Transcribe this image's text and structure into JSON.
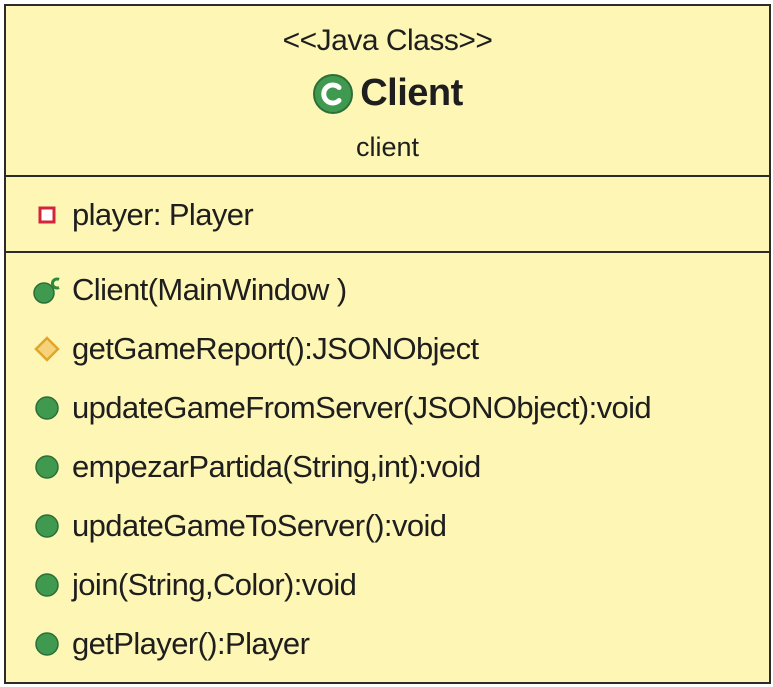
{
  "class_box": {
    "stereotype": "<<Java Class>>",
    "name": "Client",
    "package": "client"
  },
  "attributes": [
    {
      "text": "player: Player",
      "visibility": "private",
      "icon": "private-field-icon"
    }
  ],
  "operations": [
    {
      "text": "Client(MainWindow )",
      "visibility": "public",
      "icon": "constructor-icon"
    },
    {
      "text": "getGameReport():JSONObject",
      "visibility": "protected",
      "icon": "protected-method-icon"
    },
    {
      "text": "updateGameFromServer(JSONObject):void",
      "visibility": "public",
      "icon": "public-method-icon"
    },
    {
      "text": "empezarPartida(String,int):void",
      "visibility": "public",
      "icon": "public-method-icon"
    },
    {
      "text": "updateGameToServer():void",
      "visibility": "public",
      "icon": "public-method-icon"
    },
    {
      "text": "join(String,Color):void",
      "visibility": "public",
      "icon": "public-method-icon"
    },
    {
      "text": "getPlayer():Player",
      "visibility": "public",
      "icon": "public-method-icon"
    }
  ],
  "colors": {
    "fill": "#fdf6b4",
    "border": "#2b2b2b",
    "public": "#3f9a4f",
    "protected": "#e0a62c",
    "private": "#d3243a"
  }
}
